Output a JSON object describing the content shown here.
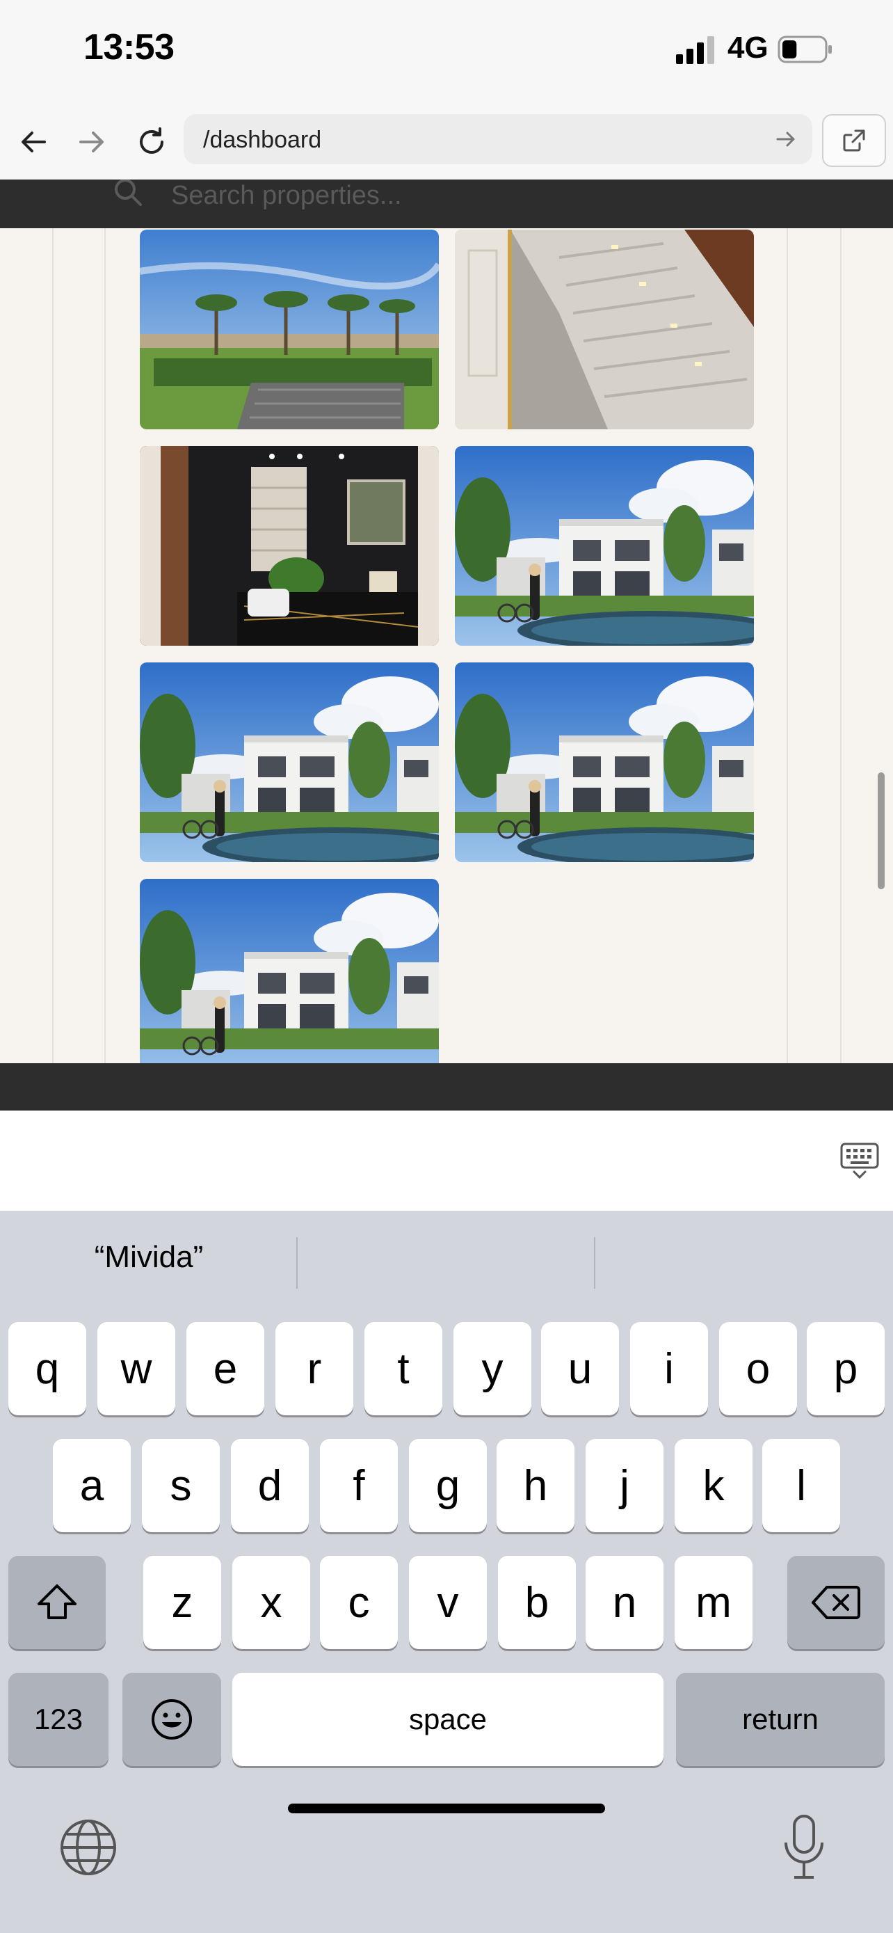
{
  "status_bar": {
    "time": "13:53",
    "network": "4G",
    "signal_bars": 3,
    "battery_level": 0.35
  },
  "browser": {
    "url": "/dashboard"
  },
  "search": {
    "placeholder": "Search properties..."
  },
  "gallery": {
    "photos": [
      {
        "subject": "villa garden with palm trees"
      },
      {
        "subject": "marble staircase with step lights"
      },
      {
        "subject": "dark marble bathroom"
      },
      {
        "subject": "modern villa rendering with pond"
      },
      {
        "subject": "modern villa rendering with pond"
      },
      {
        "subject": "modern villa rendering with pond"
      },
      {
        "subject": "modern villa rendering with pond"
      }
    ]
  },
  "keyboard": {
    "suggestions": [
      "“Mivida”",
      "",
      ""
    ],
    "rows": [
      [
        "q",
        "w",
        "e",
        "r",
        "t",
        "y",
        "u",
        "i",
        "o",
        "p"
      ],
      [
        "a",
        "s",
        "d",
        "f",
        "g",
        "h",
        "j",
        "k",
        "l"
      ],
      [
        "z",
        "x",
        "c",
        "v",
        "b",
        "n",
        "m"
      ]
    ],
    "numbers_label": "123",
    "space_label": "space",
    "return_label": "return"
  },
  "colors": {
    "keyboard_bg": "#d3d5dc",
    "dark_strip": "#2d2d2d",
    "content_bg": "#f7f4ef"
  }
}
